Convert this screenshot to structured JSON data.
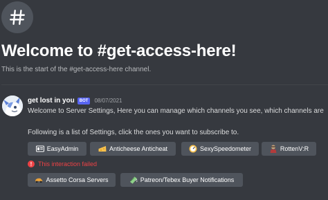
{
  "channel": {
    "welcome_title": "Welcome to #get-access-here!",
    "start_text": "This is the start of the #get-access-here channel."
  },
  "message": {
    "username": "get lost in you",
    "bot_badge": "BOT",
    "timestamp": "08/07/2021",
    "line1": "Welcome to Server Settings, Here you can manage which channels you see, which channels are",
    "line2": "Following is a list of Settings, click the ones you want to subscribe to."
  },
  "buttons_row1": [
    {
      "label": "EasyAdmin",
      "icon": "easyadmin-icon"
    },
    {
      "label": "Anticheese Anticheat",
      "icon": "cheese-icon"
    },
    {
      "label": "SexySpeedometer",
      "icon": "speedometer-icon"
    },
    {
      "label": "RottenV:R",
      "icon": "zombie-icon"
    }
  ],
  "error": {
    "text": "This interaction failed",
    "icon": "error-icon"
  },
  "buttons_row2": [
    {
      "label": "Assetto Corsa Servers",
      "icon": "car-icon"
    },
    {
      "label": "Patreon/Tebex Buyer Notifications",
      "icon": "money-icon"
    }
  ],
  "colors": {
    "background": "#36393f",
    "button": "#4f545c",
    "bot_badge": "#5865f2",
    "error": "#ed4245"
  }
}
